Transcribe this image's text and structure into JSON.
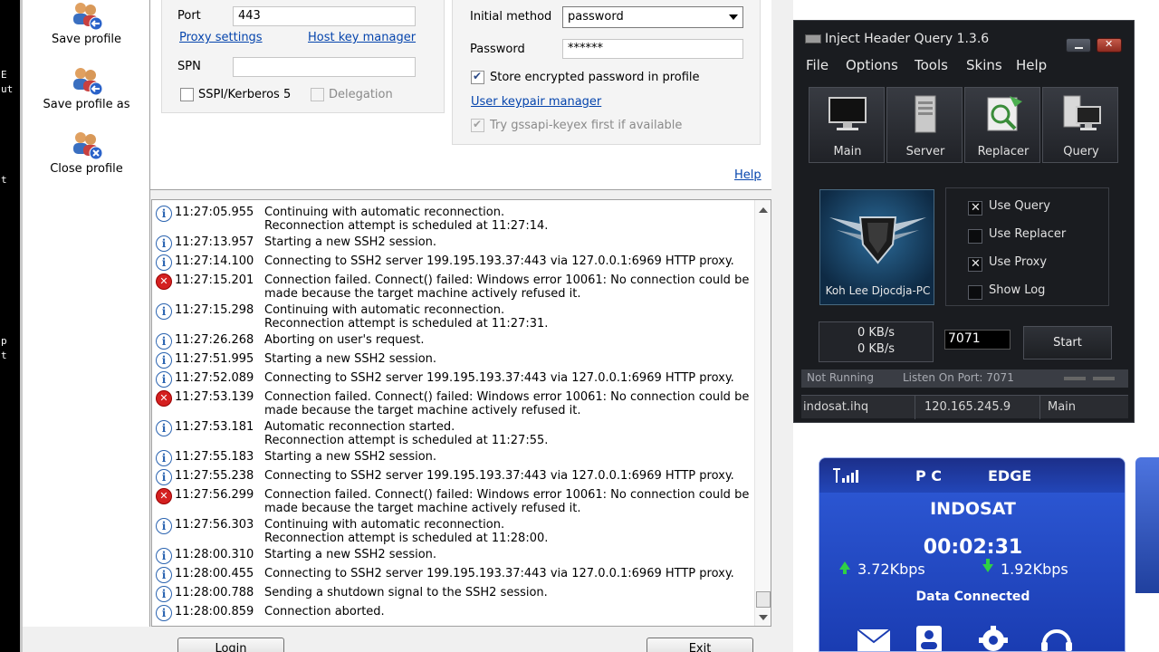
{
  "edge_glyphs": [
    "E",
    "ut",
    "t",
    "p",
    "t"
  ],
  "profile": {
    "save": "Save profile",
    "save_as": "Save profile as",
    "close": "Close profile"
  },
  "connection": {
    "port_label": "Port",
    "port_value": "443",
    "proxy_settings": "Proxy settings",
    "host_key_manager": "Host key manager",
    "spn_label": "SPN",
    "spn_value": "",
    "sspi_label": "SSPI/Kerberos 5",
    "delegation_label": "Delegation"
  },
  "auth": {
    "initial_method_label": "Initial method",
    "initial_method_value": "password",
    "password_label": "Password",
    "password_value": "******",
    "store_password_label": "Store encrypted password in profile",
    "keypair_manager": "User keypair manager",
    "gssapi_label": "Try gssapi-keyex first if available",
    "help": "Help"
  },
  "log": [
    {
      "type": "info",
      "time": "11:27:05.955",
      "msg": "Continuing with automatic reconnection.\nReconnection attempt is scheduled at 11:27:14."
    },
    {
      "type": "info",
      "time": "11:27:13.957",
      "msg": "Starting a new SSH2 session."
    },
    {
      "type": "info",
      "time": "11:27:14.100",
      "msg": "Connecting to SSH2 server 199.195.193.37:443 via 127.0.0.1:6969 HTTP proxy."
    },
    {
      "type": "err",
      "time": "11:27:15.201",
      "msg": "Connection failed. Connect() failed: Windows error 10061: No connection could be\nmade because the target machine actively refused it."
    },
    {
      "type": "info",
      "time": "11:27:15.298",
      "msg": "Continuing with automatic reconnection.\nReconnection attempt is scheduled at 11:27:31."
    },
    {
      "type": "info",
      "time": "11:27:26.268",
      "msg": "Aborting on user's request."
    },
    {
      "type": "info",
      "time": "11:27:51.995",
      "msg": "Starting a new SSH2 session."
    },
    {
      "type": "info",
      "time": "11:27:52.089",
      "msg": "Connecting to SSH2 server 199.195.193.37:443 via 127.0.0.1:6969 HTTP proxy."
    },
    {
      "type": "err",
      "time": "11:27:53.139",
      "msg": "Connection failed. Connect() failed: Windows error 10061: No connection could be\nmade because the target machine actively refused it."
    },
    {
      "type": "info",
      "time": "11:27:53.181",
      "msg": "Automatic reconnection started.\nReconnection attempt is scheduled at 11:27:55."
    },
    {
      "type": "info",
      "time": "11:27:55.183",
      "msg": "Starting a new SSH2 session."
    },
    {
      "type": "info",
      "time": "11:27:55.238",
      "msg": "Connecting to SSH2 server 199.195.193.37:443 via 127.0.0.1:6969 HTTP proxy."
    },
    {
      "type": "err",
      "time": "11:27:56.299",
      "msg": "Connection failed. Connect() failed: Windows error 10061: No connection could be\nmade because the target machine actively refused it."
    },
    {
      "type": "info",
      "time": "11:27:56.303",
      "msg": "Continuing with automatic reconnection.\nReconnection attempt is scheduled at 11:28:00."
    },
    {
      "type": "info",
      "time": "11:28:00.310",
      "msg": "Starting a new SSH2 session."
    },
    {
      "type": "info",
      "time": "11:28:00.455",
      "msg": "Connecting to SSH2 server 199.195.193.37:443 via 127.0.0.1:6969 HTTP proxy."
    },
    {
      "type": "info",
      "time": "11:28:00.788",
      "msg": "Sending a shutdown signal to the SSH2 session."
    },
    {
      "type": "info",
      "time": "11:28:00.859",
      "msg": "Connection aborted."
    }
  ],
  "buttons": {
    "login": "Login",
    "exit": "Exit"
  },
  "ihq": {
    "title": "Inject Header Query 1.3.6",
    "menu": [
      "File",
      "Options",
      "Tools",
      "Skins",
      "Help"
    ],
    "tabs": [
      "Main",
      "Server",
      "Replacer",
      "Query"
    ],
    "user": "Koh Lee Djocdja-PC",
    "options": [
      {
        "label": "Use Query",
        "checked": true
      },
      {
        "label": "Use Replacer",
        "checked": false
      },
      {
        "label": "Use Proxy",
        "checked": true
      },
      {
        "label": "Show Log",
        "checked": false
      }
    ],
    "speed_up": "0 KB/s",
    "speed_down": "0 KB/s",
    "port": "7071",
    "start": "Start",
    "status": "Not Running",
    "listen": "Listen On Port: 7071",
    "bar": [
      "indosat.ihq",
      "120.165.245.9",
      "Main"
    ]
  },
  "modem": {
    "network": "P  C",
    "mode": "EDGE",
    "operator": "INDOSAT",
    "timer": "00:02:31",
    "upload": "3.72Kbps",
    "download": "1.92Kbps",
    "status": "Data Connected",
    "signal_icon": "signal-icon"
  }
}
